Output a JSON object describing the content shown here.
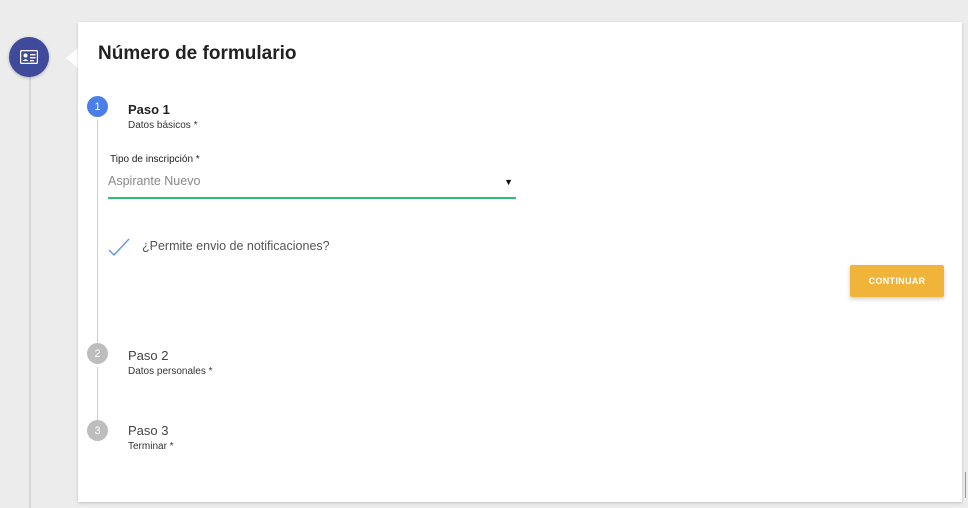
{
  "form": {
    "title": "Número de formulario",
    "badge_icon": "id-card-icon"
  },
  "steps": [
    {
      "number": "1",
      "title": "Paso 1",
      "subtitle": "Datos básicos *",
      "state": "active"
    },
    {
      "number": "2",
      "title": "Paso 2",
      "subtitle": "Datos personales *",
      "state": "inactive"
    },
    {
      "number": "3",
      "title": "Paso 3",
      "subtitle": "Terminar *",
      "state": "inactive"
    }
  ],
  "step1": {
    "select_label": "Tipo de inscripción *",
    "select_value": "Aspirante Nuevo",
    "checkbox_label": "¿Permite envio de notificaciones?",
    "checkbox_checked": true,
    "continue_label": "CONTINUAR"
  },
  "colors": {
    "badge": "#3f4a9b",
    "active_step": "#4a7ee8",
    "inactive_step": "#bdbdbd",
    "select_underline": "#2ebd72",
    "check_mark": "#5b8def",
    "continue_button": "#f0b43a"
  }
}
